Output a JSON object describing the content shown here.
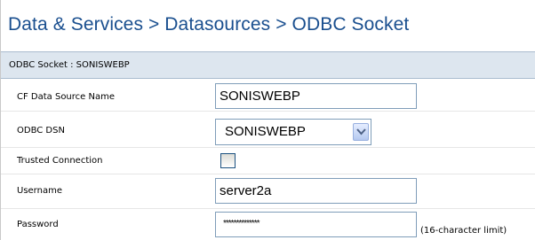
{
  "page_title": "Data & Services > Datasources > ODBC Socket",
  "subheader": "ODBC Socket : SONISWEBP",
  "fields": {
    "cf_data_source_name": {
      "label": "CF Data Source Name",
      "value": "SONISWEBP"
    },
    "odbc_dsn": {
      "label": "ODBC DSN",
      "value": "SONISWEBP"
    },
    "trusted_connection": {
      "label": "Trusted Connection",
      "checked": false
    },
    "username": {
      "label": "Username",
      "value": "server2a"
    },
    "password": {
      "label": "Password",
      "value": "**************",
      "note": "(16-character limit)"
    }
  },
  "colors": {
    "title": "#1a4f8f",
    "subheader_bg": "#dde6ef",
    "input_border": "#7f9db9"
  }
}
